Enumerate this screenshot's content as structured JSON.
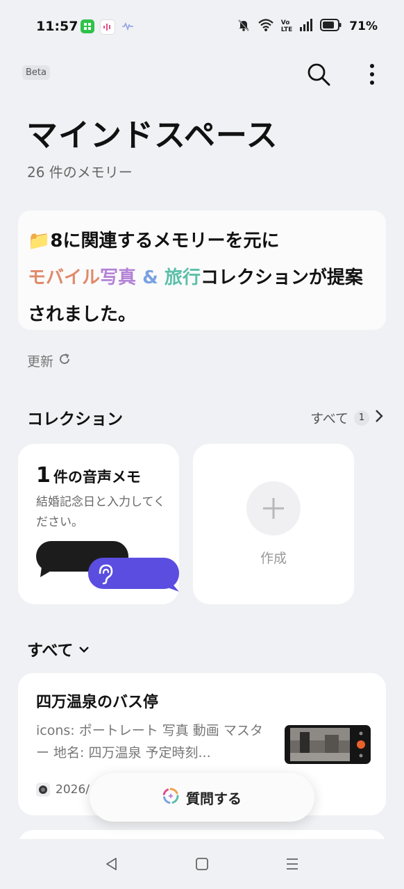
{
  "status_bar": {
    "time": "11:57",
    "battery": "71%",
    "notification_icons": [
      "app-notification-icon",
      "voice-notification-icon",
      "waveform-notification-icon"
    ],
    "system_icons": [
      "mute-bell-icon",
      "wifi-icon",
      "volte-icon",
      "signal-icon",
      "battery-icon"
    ],
    "volte_label_top": "Vo",
    "volte_label_bottom": "LTE"
  },
  "header": {
    "beta_label": "Beta",
    "title": "マインドスペース",
    "memory_count": "26 件のメモリー",
    "search_icon": "search-icon",
    "more_icon": "more-vertical-icon"
  },
  "suggestion": {
    "prefix": "📁8に関連するメモリーを元に",
    "highlight_1": "モバイル",
    "highlight_2": "写真",
    "amp": " & ",
    "highlight_3": "旅行",
    "suffix": "コレクションが提案されました。"
  },
  "refresh": {
    "label": "更新",
    "icon": "refresh-icon"
  },
  "collections": {
    "title": "コレクション",
    "see_all": "すべて",
    "count": "1",
    "voice_memo": {
      "count": "1",
      "label": "件の音声メモ",
      "description": "結婚記念日と入力してください。"
    },
    "create_label": "作成"
  },
  "all_section": {
    "label": "すべて"
  },
  "memory_item": {
    "title": "四万温泉のバス停",
    "description": "icons: ポートレート 写真 動画 マスター 地名: 四万温泉 予定時刻...",
    "date": "2026/"
  },
  "ask_button": {
    "label": "質問する"
  },
  "colors": {
    "background": "#f0f1f4",
    "card": "#ffffff",
    "voice_bubble": "#5b4de0",
    "highlight_colors": [
      "#e08a6a",
      "#b382d6",
      "#79a2e2",
      "#5bbfa8"
    ]
  }
}
